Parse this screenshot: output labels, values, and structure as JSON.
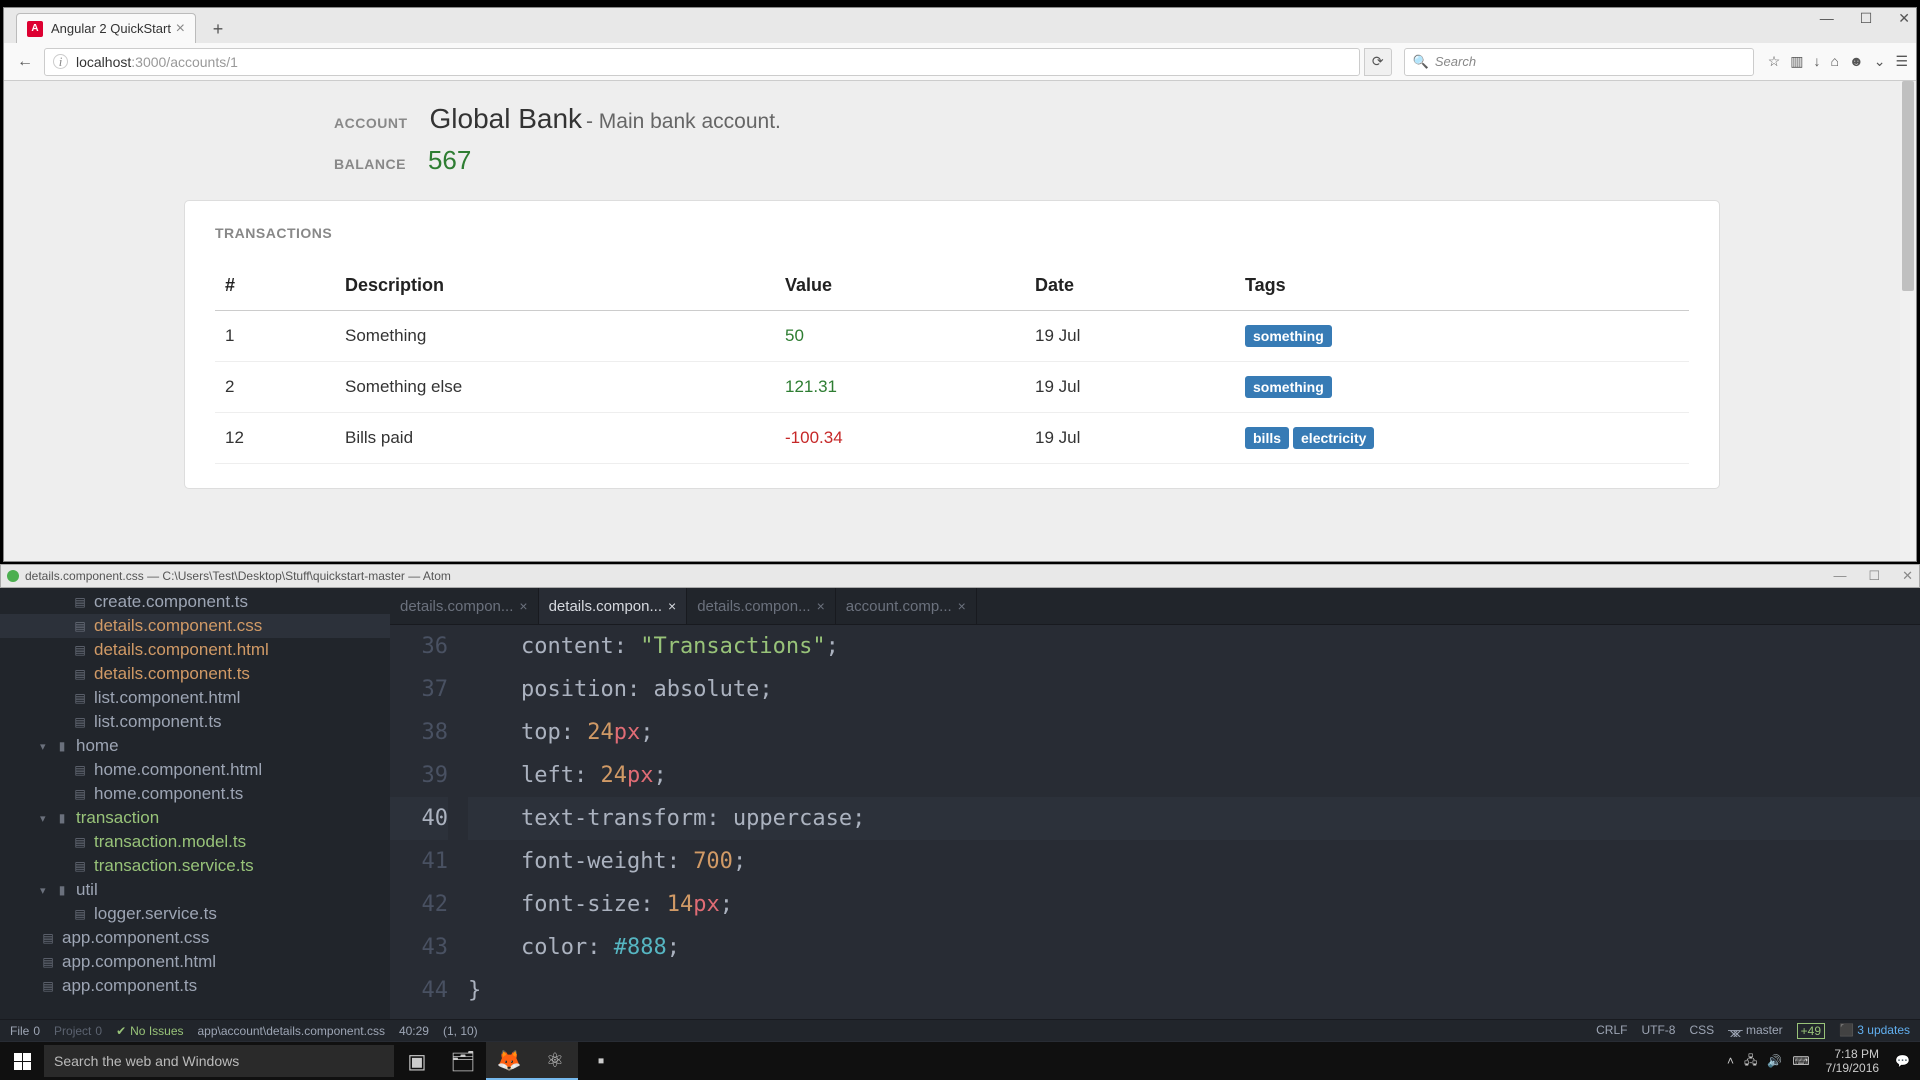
{
  "firefox": {
    "tab_title": "Angular 2 QuickStart",
    "url_host": "localhost",
    "url_rest": ":3000/accounts/1",
    "search_placeholder": "Search"
  },
  "page": {
    "account_label": "Account",
    "account_name": "Global Bank",
    "account_desc": " - Main bank account.",
    "balance_label": "Balance",
    "balance_value": "567",
    "panel_title": "Transactions",
    "headers": {
      "num": "#",
      "desc": "Description",
      "val": "Value",
      "date": "Date",
      "tags": "Tags"
    },
    "rows": [
      {
        "num": "1",
        "desc": "Something",
        "val": "50",
        "neg": false,
        "date": "19 Jul",
        "tags": [
          "something"
        ]
      },
      {
        "num": "2",
        "desc": "Something else",
        "val": "121.31",
        "neg": false,
        "date": "19 Jul",
        "tags": [
          "something"
        ]
      },
      {
        "num": "12",
        "desc": "Bills paid",
        "val": "-100.34",
        "neg": true,
        "date": "19 Jul",
        "tags": [
          "bills",
          "electricity"
        ]
      }
    ]
  },
  "atom": {
    "title": "details.component.css — C:\\Users\\Test\\Desktop\\Stuff\\quickstart-master — Atom",
    "tree": [
      {
        "name": "create.component.ts",
        "ind": 2,
        "icn": "▦",
        "mod": false
      },
      {
        "name": "details.component.css",
        "ind": 2,
        "icn": "▦",
        "mod": true,
        "sel": true
      },
      {
        "name": "details.component.html",
        "ind": 2,
        "icn": "▦",
        "mod": true
      },
      {
        "name": "details.component.ts",
        "ind": 2,
        "icn": "▦",
        "mod": true
      },
      {
        "name": "list.component.html",
        "ind": 2,
        "icn": "▦",
        "mod": false
      },
      {
        "name": "list.component.ts",
        "ind": 2,
        "icn": "▦",
        "mod": false
      },
      {
        "name": "home",
        "ind": 1,
        "icn": "▾📁",
        "fold": true
      },
      {
        "name": "home.component.html",
        "ind": 2,
        "icn": "▦",
        "mod": false
      },
      {
        "name": "home.component.ts",
        "ind": 2,
        "icn": "▦",
        "mod": false
      },
      {
        "name": "transaction",
        "ind": 1,
        "icn": "▾📁",
        "fold": true,
        "new": true
      },
      {
        "name": "transaction.model.ts",
        "ind": 2,
        "icn": "▦",
        "new": true
      },
      {
        "name": "transaction.service.ts",
        "ind": 2,
        "icn": "▦",
        "new": true
      },
      {
        "name": "util",
        "ind": 1,
        "icn": "▾📁",
        "fold": true
      },
      {
        "name": "logger.service.ts",
        "ind": 2,
        "icn": "▦",
        "mod": false
      },
      {
        "name": "app.component.css",
        "ind": 1,
        "icn": "▦",
        "mod": false
      },
      {
        "name": "app.component.html",
        "ind": 1,
        "icn": "▦",
        "mod": false
      },
      {
        "name": "app.component.ts",
        "ind": 1,
        "icn": "▦",
        "mod": false
      }
    ],
    "tabs": [
      {
        "label": "details.compon...",
        "active": false,
        "close": "×"
      },
      {
        "label": "details.compon...",
        "active": true,
        "close": "×"
      },
      {
        "label": "details.compon...",
        "active": false,
        "close": "×"
      },
      {
        "label": "account.comp...",
        "active": false,
        "close": "×"
      }
    ],
    "code": {
      "start": 36,
      "current": 40,
      "lines": [
        [
          {
            "t": "    "
          },
          {
            "t": "content",
            "c": "prop"
          },
          {
            "t": ": "
          },
          {
            "t": "\"Transactions\"",
            "c": "str"
          },
          {
            "t": ";"
          }
        ],
        [
          {
            "t": "    "
          },
          {
            "t": "position",
            "c": "prop"
          },
          {
            "t": ": "
          },
          {
            "t": "absolute",
            "c": "kw"
          },
          {
            "t": ";"
          }
        ],
        [
          {
            "t": "    "
          },
          {
            "t": "top",
            "c": "prop"
          },
          {
            "t": ": "
          },
          {
            "t": "24",
            "c": "num"
          },
          {
            "t": "px",
            "c": "unit"
          },
          {
            "t": ";"
          }
        ],
        [
          {
            "t": "    "
          },
          {
            "t": "left",
            "c": "prop"
          },
          {
            "t": ": "
          },
          {
            "t": "24",
            "c": "num"
          },
          {
            "t": "px",
            "c": "unit"
          },
          {
            "t": ";"
          }
        ],
        [
          {
            "t": "    "
          },
          {
            "t": "text-transform",
            "c": "prop"
          },
          {
            "t": ": "
          },
          {
            "t": "uppercase",
            "c": "kw"
          },
          {
            "t": ";"
          }
        ],
        [
          {
            "t": "    "
          },
          {
            "t": "font-weight",
            "c": "prop"
          },
          {
            "t": ": "
          },
          {
            "t": "700",
            "c": "num"
          },
          {
            "t": ";"
          }
        ],
        [
          {
            "t": "    "
          },
          {
            "t": "font-size",
            "c": "prop"
          },
          {
            "t": ": "
          },
          {
            "t": "14",
            "c": "num"
          },
          {
            "t": "px",
            "c": "unit"
          },
          {
            "t": ";"
          }
        ],
        [
          {
            "t": "    "
          },
          {
            "t": "color",
            "c": "prop"
          },
          {
            "t": ": "
          },
          {
            "t": "#888",
            "c": "const"
          },
          {
            "t": ";"
          }
        ],
        [
          {
            "t": "}"
          }
        ]
      ]
    },
    "status": {
      "file": "File",
      "file_count": "0",
      "project": "Project",
      "proj_count": "0",
      "no_issues": "No Issues",
      "path": "app\\account\\details.component.css",
      "pos": "40:29",
      "sel": "(1, 10)",
      "crlf": "CRLF",
      "enc": "UTF-8",
      "lang": "CSS",
      "branch": "master",
      "diff": "+49",
      "updates": "3 updates"
    }
  },
  "taskbar": {
    "search_placeholder": "Search the web and Windows",
    "time": "7:18 PM",
    "date": "7/19/2016"
  }
}
